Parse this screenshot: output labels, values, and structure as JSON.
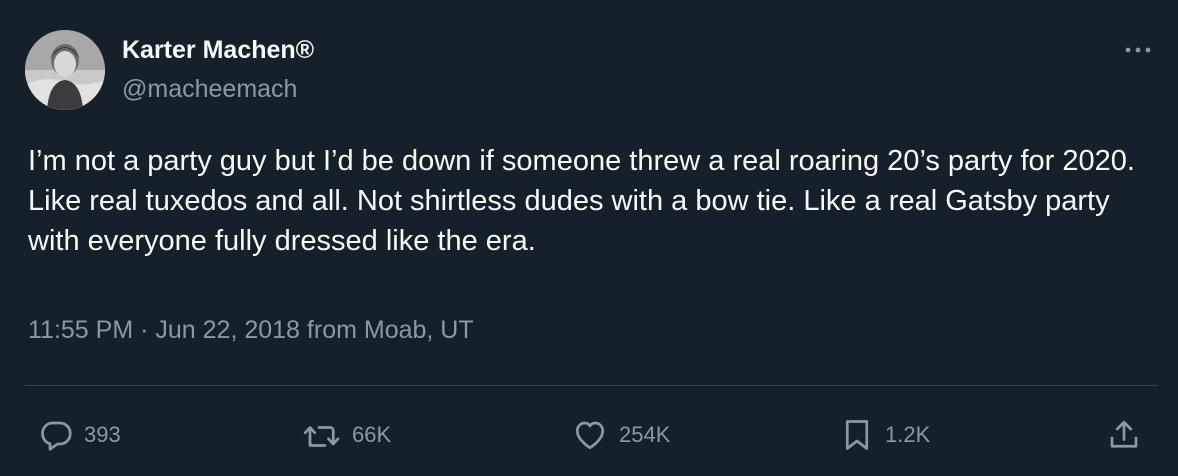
{
  "author": {
    "display_name": "Karter Machen®",
    "handle": "@macheemach"
  },
  "tweet": {
    "text": "I’m not a party guy but I’d be down if someone threw a real roaring 20’s party for 2020. Like real tuxedos and all. Not shirtless dudes with a bow tie. Like a real Gatsby party with everyone fully dressed like the era.",
    "time": "11:55 PM",
    "separator": "·",
    "date": "Jun 22, 2018",
    "location": "from Moab, UT"
  },
  "actions": {
    "replies": "393",
    "retweets": "66K",
    "likes": "254K",
    "bookmarks": "1.2K"
  },
  "icons": {
    "more": "more-dots-icon",
    "reply": "reply-icon",
    "retweet": "retweet-icon",
    "like": "heart-icon",
    "bookmark": "bookmark-icon",
    "share": "share-icon"
  },
  "colors": {
    "background": "#15202b",
    "text": "#f7f9f9",
    "secondary": "#8b98a5",
    "divider": "#38444d"
  }
}
